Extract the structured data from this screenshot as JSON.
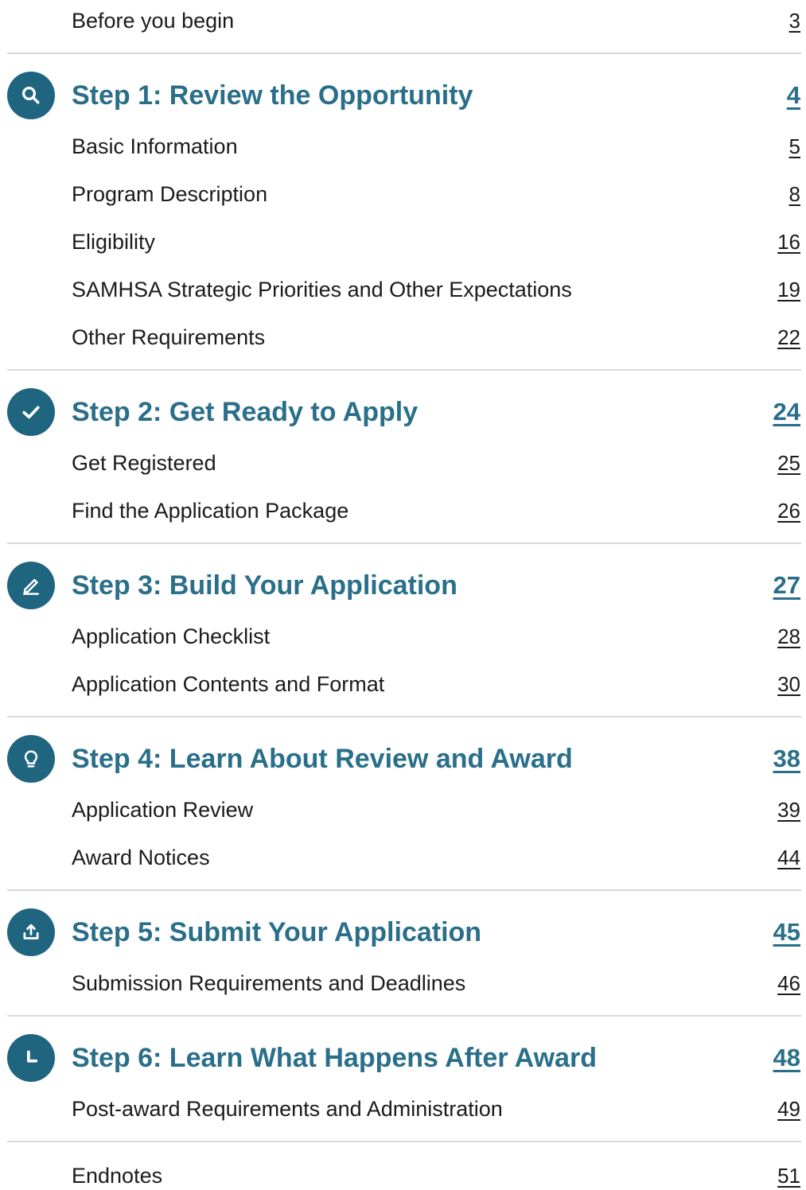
{
  "toc": {
    "before_you_begin": {
      "label": "Before you begin",
      "page": "3"
    },
    "steps": [
      {
        "label": "Step 1: Review the Opportunity",
        "page": "4",
        "items": [
          {
            "label": "Basic Information",
            "page": "5"
          },
          {
            "label": "Program Description",
            "page": "8"
          },
          {
            "label": "Eligibility",
            "page": "16"
          },
          {
            "label": "SAMHSA Strategic Priorities and Other Expectations",
            "page": "19"
          },
          {
            "label": "Other Requirements",
            "page": "22"
          }
        ]
      },
      {
        "label": "Step 2: Get Ready to Apply",
        "page": "24",
        "items": [
          {
            "label": "Get Registered",
            "page": "25"
          },
          {
            "label": "Find the Application Package",
            "page": "26"
          }
        ]
      },
      {
        "label": "Step 3: Build Your Application",
        "page": "27",
        "items": [
          {
            "label": "Application Checklist",
            "page": "28"
          },
          {
            "label": "Application Contents and Format",
            "page": "30"
          }
        ]
      },
      {
        "label": "Step 4: Learn About Review and Award",
        "page": "38",
        "items": [
          {
            "label": "Application Review",
            "page": "39"
          },
          {
            "label": "Award Notices",
            "page": "44"
          }
        ]
      },
      {
        "label": "Step 5: Submit Your Application",
        "page": "45",
        "items": [
          {
            "label": "Submission Requirements and Deadlines",
            "page": "46"
          }
        ]
      },
      {
        "label": "Step 6: Learn What Happens After Award",
        "page": "48",
        "items": [
          {
            "label": "Post-award Requirements and Administration",
            "page": "49"
          }
        ]
      }
    ],
    "endnotes": {
      "label": "Endnotes",
      "page": "51"
    }
  },
  "icons": [
    "search-icon",
    "checkmark-icon",
    "pencil-icon",
    "lightbulb-icon",
    "upload-icon",
    "clock-icon"
  ],
  "colors": {
    "heading": "#2a6f8a",
    "icon_bg": "#1f6580",
    "divider": "#d6dadc",
    "text": "#1b1b1b"
  }
}
